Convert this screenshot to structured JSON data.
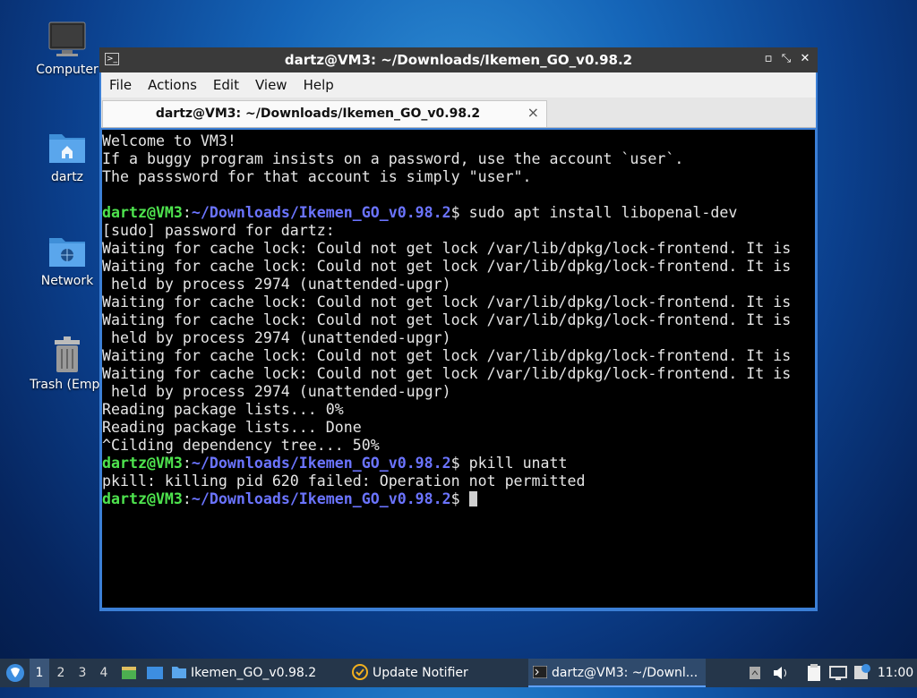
{
  "desktop": {
    "icons": [
      {
        "label": "Computer",
        "icon": "monitor-icon"
      },
      {
        "label": "dartz",
        "icon": "home-folder-icon"
      },
      {
        "label": "Network",
        "icon": "network-folder-icon"
      },
      {
        "label": "Trash (Empt",
        "icon": "trash-icon"
      }
    ]
  },
  "window": {
    "title": "dartz@VM3: ~/Downloads/Ikemen_GO_v0.98.2",
    "menu": [
      "File",
      "Actions",
      "Edit",
      "View",
      "Help"
    ],
    "tab_label": "dartz@VM3: ~/Downloads/Ikemen_GO_v0.98.2",
    "tab_close": "×",
    "buttons": {
      "minimize": "▫",
      "restore": "⤡",
      "close": "✕"
    }
  },
  "terminal": {
    "prompt_user": "dartz@VM3",
    "prompt_path": "~/Downloads/Ikemen_GO_v0.98.2",
    "lines": [
      "Welcome to VM3!",
      "If a buggy program insists on a password, use the account `user`.",
      "The passsword for that account is simply \"user\".",
      "",
      "__PROMPT__ sudo apt install libopenal-dev",
      "[sudo] password for dartz:",
      "Waiting for cache lock: Could not get lock /var/lib/dpkg/lock-frontend. It is",
      "Waiting for cache lock: Could not get lock /var/lib/dpkg/lock-frontend. It is",
      " held by process 2974 (unattended-upgr)",
      "Waiting for cache lock: Could not get lock /var/lib/dpkg/lock-frontend. It is",
      "Waiting for cache lock: Could not get lock /var/lib/dpkg/lock-frontend. It is",
      " held by process 2974 (unattended-upgr)",
      "Waiting for cache lock: Could not get lock /var/lib/dpkg/lock-frontend. It is",
      "Waiting for cache lock: Could not get lock /var/lib/dpkg/lock-frontend. It is",
      " held by process 2974 (unattended-upgr)",
      "Reading package lists... 0%",
      "Reading package lists... Done",
      "^Cilding dependency tree... 50%",
      "__PROMPT__ pkill unatt",
      "pkill: killing pid 620 failed: Operation not permitted",
      "__PROMPT__ __CURSOR__"
    ]
  },
  "taskbar": {
    "workspaces": [
      "1",
      "2",
      "3",
      "4"
    ],
    "active_workspace": "1",
    "tasks": [
      {
        "label": "Ikemen_GO_v0.98.2",
        "icon": "folder-icon"
      },
      {
        "label": "Update Notifier",
        "icon": "update-notifier-icon"
      },
      {
        "label": "dartz@VM3: ~/Downl...",
        "icon": "terminal-icon"
      }
    ],
    "clock": "11:00"
  },
  "colors": {
    "prompt_user": "#4ee44e",
    "prompt_path": "#6b74ff",
    "terminal_bg": "#000000",
    "taskbar_bg": "#25364a"
  }
}
